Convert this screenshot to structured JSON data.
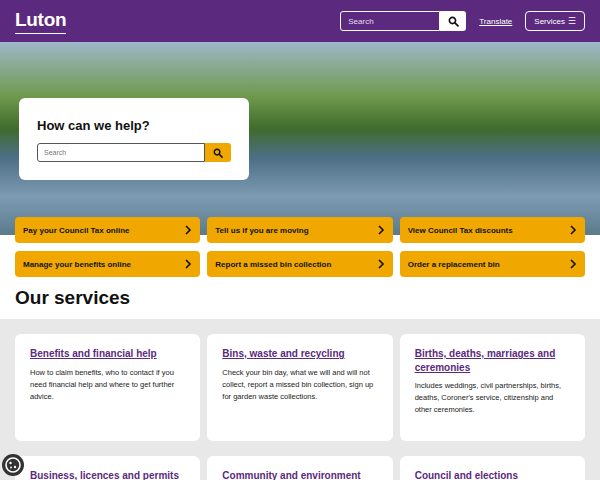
{
  "header": {
    "logo": "Luton",
    "search_placeholder": "Search",
    "translate": "Translate",
    "services": {
      "label": "Services",
      "icon": "☰"
    }
  },
  "hero": {
    "heading": "How can we help?",
    "search_placeholder": "Search"
  },
  "quick_links": [
    "Pay your Council Tax online",
    "Tell us if you are moving",
    "View Council Tax discounts",
    "Manage your benefits online",
    "Report a missed bin collection",
    "Order a replacement bin"
  ],
  "services_heading": "Our services",
  "services": [
    {
      "title": "Benefits and financial help",
      "description": "How to claim benefits, who to contact if you need financial help and where to get further advice."
    },
    {
      "title": "Bins, waste and recycling",
      "description": "Check your bin day, what we will and will not collect, report a missed bin collection, sign up for garden waste collections."
    },
    {
      "title": "Births, deaths, marriages and ceremonies",
      "description": "Includes weddings, civil partnerships, births, deaths, Coroner's service, citizenship and other ceremonies."
    },
    {
      "title": "Business, licences and permits",
      "description": ""
    },
    {
      "title": "Community and environment",
      "description": ""
    },
    {
      "title": "Council and elections",
      "description": ""
    }
  ]
}
